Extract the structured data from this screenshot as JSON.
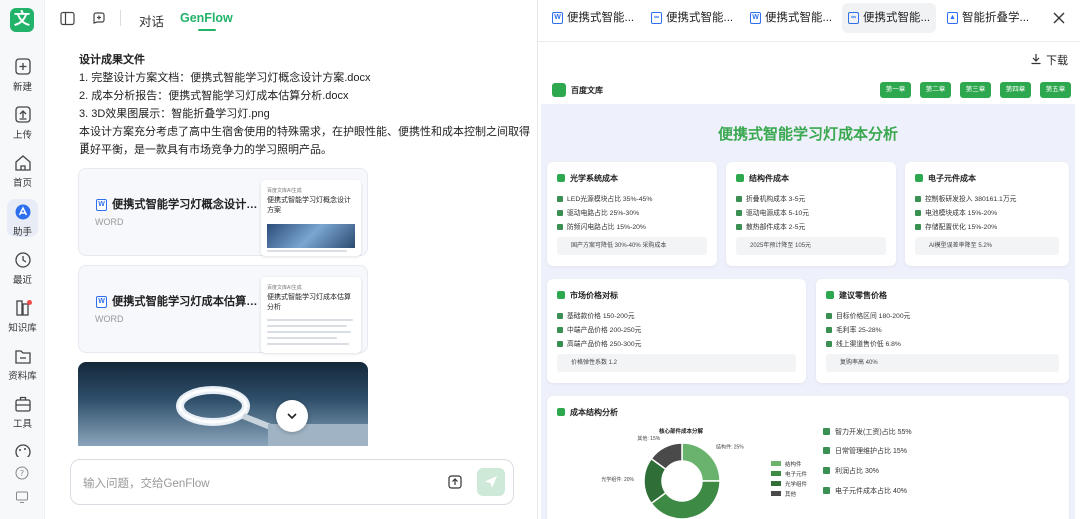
{
  "rail": {
    "logo": "文",
    "items": [
      {
        "label": "新建",
        "icon": "plus-icon"
      },
      {
        "label": "上传",
        "icon": "upload-icon"
      },
      {
        "label": "首页",
        "icon": "home-icon"
      },
      {
        "label": "助手",
        "icon": "assistant-icon"
      },
      {
        "label": "最近",
        "icon": "clock-icon"
      },
      {
        "label": "知识库",
        "icon": "knowledge-icon"
      },
      {
        "label": "资料库",
        "icon": "folder-icon"
      },
      {
        "label": "工具",
        "icon": "toolbox-icon"
      },
      {
        "label": "",
        "icon": "palette-icon"
      }
    ]
  },
  "chat": {
    "tabs": [
      "对话",
      "GenFlow"
    ],
    "active_tab": "GenFlow",
    "accent": "#21b36a",
    "message": {
      "heading": "设计成果文件",
      "items": [
        "1. 完整设计方案文档：便携式智能学习灯概念设计方案.docx",
        "2. 成本分析报告：便携式智能学习灯成本估算分析.docx",
        "3. 3D效果图展示：智能折叠学习灯.png"
      ],
      "summary_line1": "本设计方案充分考虑了高中生宿舍使用的特殊需求，在护眼性能、便携性和成本控制之间取得了",
      "summary_line2": "良好平衡，是一款具有市场竞争力的学习照明产品。"
    },
    "files": [
      {
        "title": "便携式智能学习灯概念设计方案",
        "type": "WORD",
        "thumb_source": "百度文库AI生成",
        "thumb_title": "便携式智能学习灯概念设计方案"
      },
      {
        "title": "便携式智能学习灯成本估算分析",
        "type": "WORD",
        "thumb_source": "百度文库AI生成",
        "thumb_title": "便携式智能学习灯成本估算分析"
      }
    ],
    "input_placeholder": "输入问题，交给GenFlow"
  },
  "preview": {
    "tabs": [
      {
        "label": "便携式智能...",
        "icon": "word-icon"
      },
      {
        "label": "便携式智能...",
        "icon": "link-icon"
      },
      {
        "label": "便携式智能...",
        "icon": "word-icon"
      },
      {
        "label": "便携式智能...",
        "icon": "link-icon"
      },
      {
        "label": "智能折叠学...",
        "icon": "image-icon"
      }
    ],
    "download_label": "下载",
    "doc": {
      "brand": "百度文库",
      "nav": [
        "第一章",
        "第二章",
        "第三章",
        "第四章",
        "第五章"
      ],
      "title": "便携式智能学习灯成本分析",
      "accent": "#2ea84f",
      "cards": [
        {
          "title": "光学系统成本",
          "items": [
            "LED光源模块占比 35%-45%",
            "驱动电路占比 25%-30%",
            "防频闪电路占比 15%-20%"
          ],
          "note": "国产方案可降低 30%-40% 采购成本"
        },
        {
          "title": "结构件成本",
          "items": [
            "折叠机构成本 3-5元",
            "驱动电源成本 5-10元",
            "散热部件成本 2-5元"
          ],
          "note": "2025年预计降至 105元"
        },
        {
          "title": "电子元件成本",
          "items": [
            "控制板研发投入 380161.1万元",
            "电池模块成本 15%-20%",
            "存储配置优化 15%-20%"
          ],
          "note": "AI模型误差率降至 5.2%"
        },
        {
          "title": "市场价格对标",
          "items": [
            "基础款价格 150-200元",
            "中端产品价格 200-250元",
            "高端产品价格 250-300元"
          ],
          "note": "价格弹性系数 1.2"
        },
        {
          "title": "建议零售价格",
          "items": [
            "目标价格区间 180-200元",
            "毛利率 25-28%",
            "线上渠道售价低 6.8%"
          ],
          "note": "复购率高 40%"
        }
      ],
      "chart_section_title": "成本结构分析",
      "chart_data": {
        "type": "pie",
        "title": "核心部件成本分解",
        "categories": [
          "结构件",
          "电子元件",
          "光学组件",
          "其他"
        ],
        "values": [
          25,
          40,
          20,
          15
        ],
        "labels": [
          "结构件: 25%",
          "电子元件: 40%",
          "光学组件: 20%",
          "其他: 15%"
        ],
        "colors": [
          "#6ab36e",
          "#3d8a45",
          "#2f6e36",
          "#4a4a4a"
        ]
      },
      "right_list": [
        "智力开发(工资)占比 55%",
        "日常管理维护占比 15%",
        "利润占比 30%",
        "电子元件成本占比 40%"
      ]
    }
  }
}
